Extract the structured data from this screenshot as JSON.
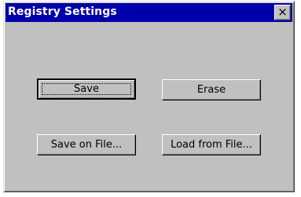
{
  "dialog": {
    "title": "Registry Settings",
    "close_glyph": "×",
    "buttons": {
      "save": "Save",
      "erase": "Erase",
      "save_on_file": "Save on File...",
      "load_from_file": "Load from File..."
    }
  },
  "colors": {
    "titlebar": "#0000a8",
    "face": "#c0c0c0"
  }
}
